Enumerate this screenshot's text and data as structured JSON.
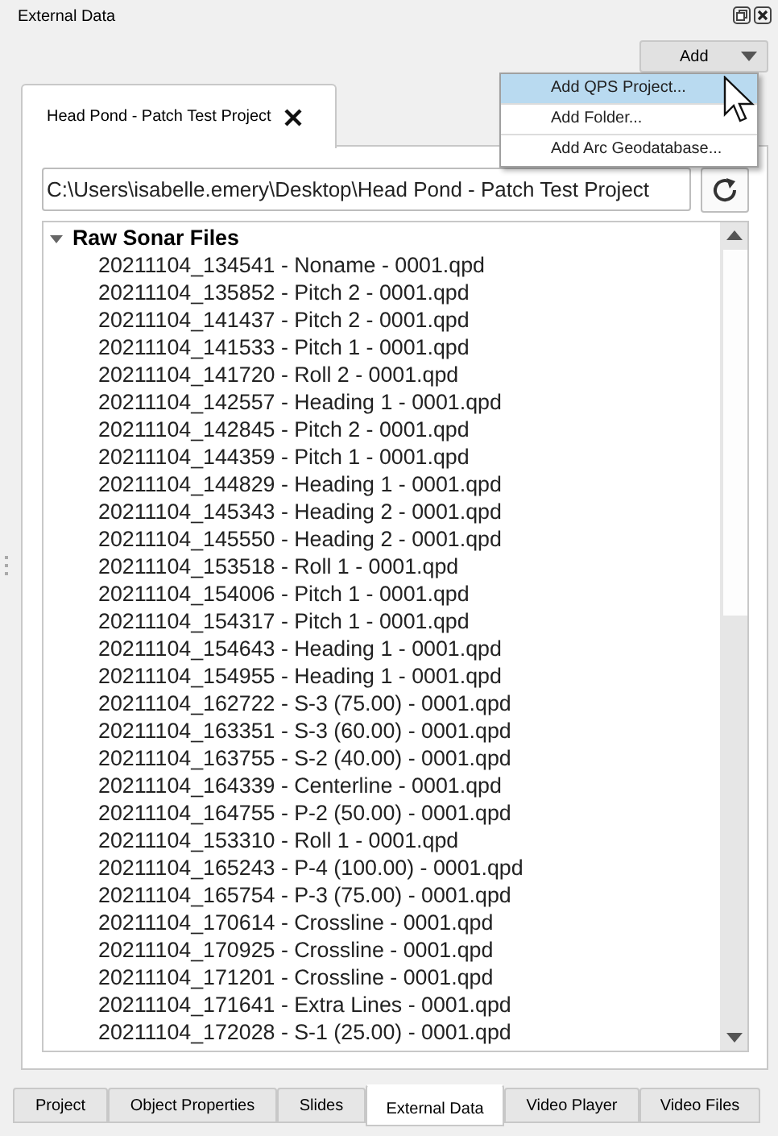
{
  "panel": {
    "title": "External Data"
  },
  "add_button": {
    "label": "Add"
  },
  "add_menu": [
    {
      "label": "Add QPS Project...",
      "selected": true
    },
    {
      "label": "Add Folder...",
      "selected": false
    },
    {
      "label": "Add Arc Geodatabase...",
      "selected": false
    }
  ],
  "document_tabs": [
    {
      "label": "Head Pond - Patch Test Project",
      "selected": true
    }
  ],
  "path_field": {
    "value": "C:\\Users\\isabelle.emery\\Desktop\\Head Pond - Patch Test Project"
  },
  "tree": [
    {
      "label": "Raw Sonar Files",
      "expanded": true,
      "children": [
        {
          "label": "20211104_134541 - Noname - 0001.qpd"
        },
        {
          "label": "20211104_135852 - Pitch 2 - 0001.qpd"
        },
        {
          "label": "20211104_141437 - Pitch 2 - 0001.qpd"
        },
        {
          "label": "20211104_141533 - Pitch 1 - 0001.qpd"
        },
        {
          "label": "20211104_141720 - Roll 2 - 0001.qpd"
        },
        {
          "label": "20211104_142557 - Heading 1 - 0001.qpd"
        },
        {
          "label": "20211104_142845 - Pitch 2 - 0001.qpd"
        },
        {
          "label": "20211104_144359 - Pitch 1 - 0001.qpd"
        },
        {
          "label": "20211104_144829 - Heading 1 - 0001.qpd"
        },
        {
          "label": "20211104_145343 - Heading 2 - 0001.qpd"
        },
        {
          "label": "20211104_145550 - Heading 2 - 0001.qpd"
        },
        {
          "label": "20211104_153518 - Roll 1 - 0001.qpd"
        },
        {
          "label": "20211104_154006 - Pitch 1 - 0001.qpd"
        },
        {
          "label": "20211104_154317 - Pitch 1 - 0001.qpd"
        },
        {
          "label": "20211104_154643 - Heading 1 - 0001.qpd"
        },
        {
          "label": "20211104_154955 - Heading 1 - 0001.qpd"
        },
        {
          "label": "20211104_162722 - S-3 (75.00) - 0001.qpd"
        },
        {
          "label": "20211104_163351 - S-3 (60.00) - 0001.qpd"
        },
        {
          "label": "20211104_163755 - S-2 (40.00) - 0001.qpd"
        },
        {
          "label": "20211104_164339 - Centerline - 0001.qpd"
        },
        {
          "label": "20211104_164755 - P-2 (50.00) - 0001.qpd"
        },
        {
          "label": "20211104_153310 - Roll 1 - 0001.qpd"
        },
        {
          "label": "20211104_165243 - P-4 (100.00) - 0001.qpd"
        },
        {
          "label": "20211104_165754 - P-3 (75.00) - 0001.qpd"
        },
        {
          "label": "20211104_170614 - Crossline - 0001.qpd"
        },
        {
          "label": "20211104_170925 - Crossline - 0001.qpd"
        },
        {
          "label": "20211104_171201 - Crossline - 0001.qpd"
        },
        {
          "label": "20211104_171641 - Extra Lines - 0001.qpd"
        },
        {
          "label": "20211104_172028 - S-1 (25.00) - 0001.qpd"
        }
      ]
    }
  ],
  "bottom_tabs": [
    {
      "label": "Project",
      "selected": false
    },
    {
      "label": "Object Properties",
      "selected": false
    },
    {
      "label": "Slides",
      "selected": false
    },
    {
      "label": "External Data",
      "selected": true
    },
    {
      "label": "Video Player",
      "selected": false
    },
    {
      "label": "Video Files",
      "selected": false
    }
  ]
}
